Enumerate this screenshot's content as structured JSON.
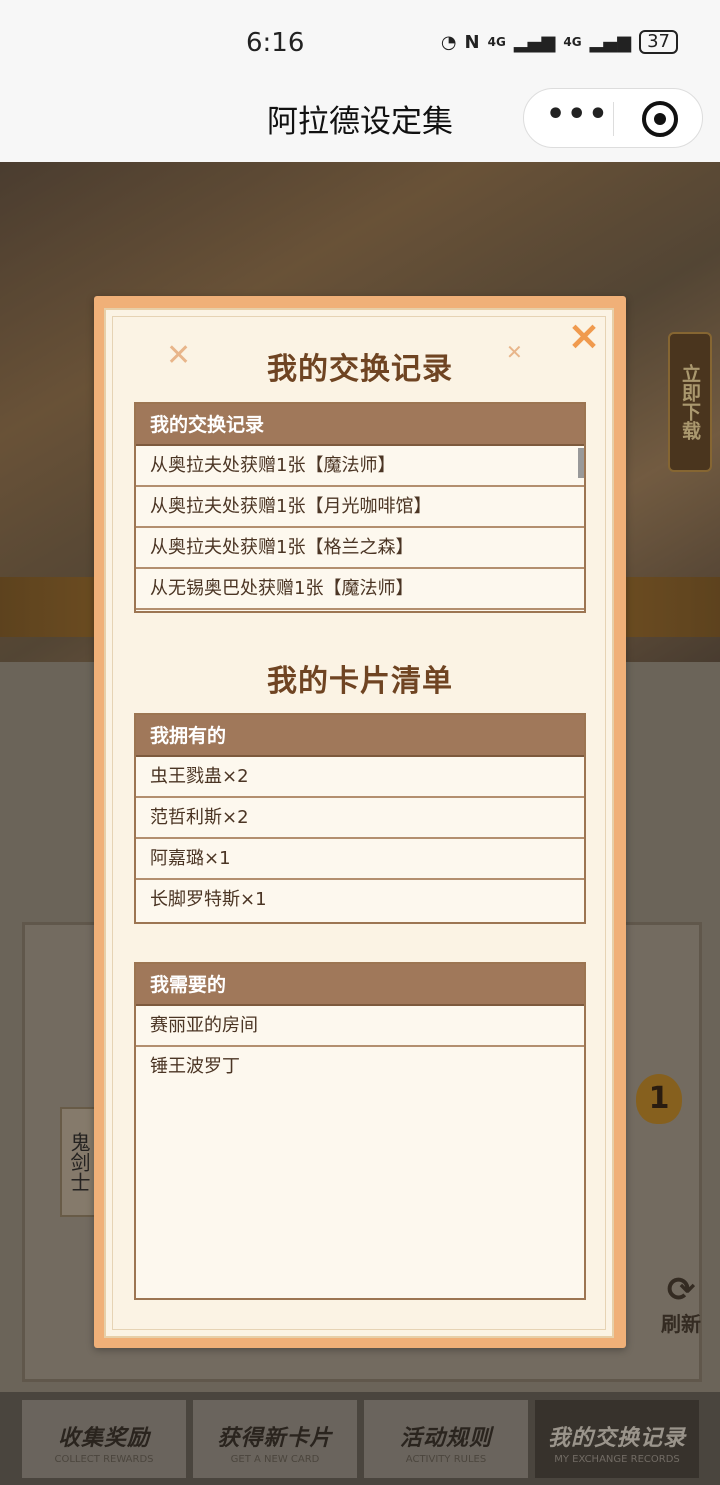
{
  "status_bar": {
    "time": "6:16",
    "battery": "37",
    "network_1": "4G",
    "network_2": "4G"
  },
  "nav": {
    "title": "阿拉德设定集",
    "more_label": "•••"
  },
  "background": {
    "download_label": "立即下载",
    "side_label": "鬼剑士",
    "count_badge": "1",
    "refresh_label": "刷新",
    "refresh_icon": "⟳"
  },
  "tabs": [
    {
      "zh": "收集奖励",
      "en": "COLLECT REWARDS"
    },
    {
      "zh": "获得新卡片",
      "en": "GET A NEW CARD"
    },
    {
      "zh": "活动规则",
      "en": "ACTIVITY RULES"
    },
    {
      "zh": "我的交换记录",
      "en": "MY EXCHANGE RECORDS"
    }
  ],
  "modal": {
    "close_icon": "×",
    "exchange": {
      "title": "我的交换记录",
      "header": "我的交换记录",
      "rows": [
        "从奥拉夫处获赠1张【魔法师】",
        "从奥拉夫处获赠1张【月光咖啡馆】",
        "从奥拉夫处获赠1张【格兰之森】",
        "从无锡奥巴处获赠1张【魔法师】"
      ]
    },
    "cards": {
      "title": "我的卡片清单",
      "owned_header": "我拥有的",
      "owned": [
        "虫王戮蛊×2",
        "范哲利斯×2",
        "阿嘉璐×1",
        "长脚罗特斯×1"
      ],
      "needed_header": "我需要的",
      "needed": [
        "赛丽亚的房间",
        "锤王波罗丁"
      ]
    }
  }
}
